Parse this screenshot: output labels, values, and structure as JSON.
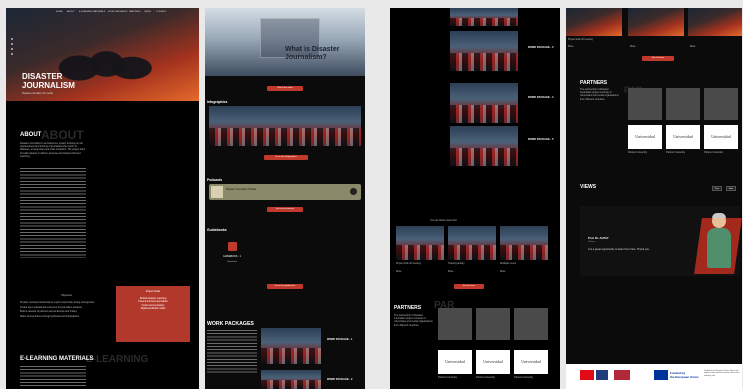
{
  "nav": {
    "items": [
      "HOME",
      "ABOUT",
      "E-LEARNING MATERIALS",
      "WORK PACKAGES",
      "PARTNERS",
      "VIEWS",
      "CONTACT"
    ]
  },
  "hero": {
    "title_line1": "DISASTER",
    "title_line2": "JOURNALISM",
    "subtitle": "Disaster journalism for media"
  },
  "about": {
    "heading": "ABOUT",
    "ghost": "ABOUT",
    "intro": "Disaster Journalism is an Erasmus+ project focusing on the preparedness and training of journalists who report on disasters, emergencies and crisis situations. The project aims to build capacity in ethical, accurate and trauma-informed reporting.",
    "bullets": [
      "Prepare media professionals to report responsibly during emergencies",
      "Create open educational resources for journalism students",
      "Build a network of partners across Europe and Turkey",
      "Share best practices through podcasts and infographics"
    ],
    "objectives_title": "Objectives",
    "red_box_title": "Project Goals",
    "red_box_items": [
      "Ethical disaster reporting",
      "Trauma-informed journalism",
      "Crisis communication",
      "Digital verification skills"
    ]
  },
  "elearning": {
    "heading": "E-LEARNING MATERIALS",
    "ghost": "E-LEARNING"
  },
  "video": {
    "title": "What is Disaster Journalism?",
    "button": "Watch the video"
  },
  "infographics": {
    "heading": "Infographics",
    "button": "Go to the infographics"
  },
  "podcasts": {
    "heading": "Podcasts",
    "episode": "Disaster Journalism Podcast",
    "button": "Go to the podcasts"
  },
  "guidebooks": {
    "heading": "Guidebooks",
    "book_title": "GUIDEBOOK - 1",
    "book_link": "Download",
    "button": "Go to the guidebooks"
  },
  "work_packages": {
    "heading": "WORK PACKAGES",
    "items": [
      {
        "label": "WORK PACKAGE - 1"
      },
      {
        "label": "WORK PACKAGE - 2"
      },
      {
        "label": "WORK PACKAGE - 3"
      },
      {
        "label": "WORK PACKAGE - 4"
      },
      {
        "label": "WORK PACKAGE - 5"
      }
    ]
  },
  "news": {
    "header": "You can follow news from",
    "cards": [
      {
        "title": "Project kick-off meeting",
        "more": "More"
      },
      {
        "title": "Training activity",
        "more": "More"
      },
      {
        "title": "Multiplier event",
        "more": "More"
      }
    ],
    "button": "See all news"
  },
  "partners": {
    "heading": "PARTNERS",
    "ghost": "PAR",
    "text": "The partnership of Disaster Journalism project consists of universities and media organisations from different countries.",
    "logo_text": "Universidad",
    "labels": [
      "Partner University",
      "Partner University",
      "Partner University"
    ]
  },
  "views": {
    "heading": "VIEWS",
    "name": "Prof. Dr. ALPAY",
    "role": "Partner",
    "quote": "It is a great opportunity to learn from here. Thank you.",
    "prev": "Prev",
    "next": "Next"
  },
  "footer": {
    "funded_line1": "Funded by",
    "funded_line2": "the European Union",
    "disclaimer": "Funded by the European Union. Views and opinions expressed are however those of the author(s) only."
  },
  "colors": {
    "accent": "#c0392b",
    "background": "#000000",
    "card": "#1a1a1a"
  }
}
